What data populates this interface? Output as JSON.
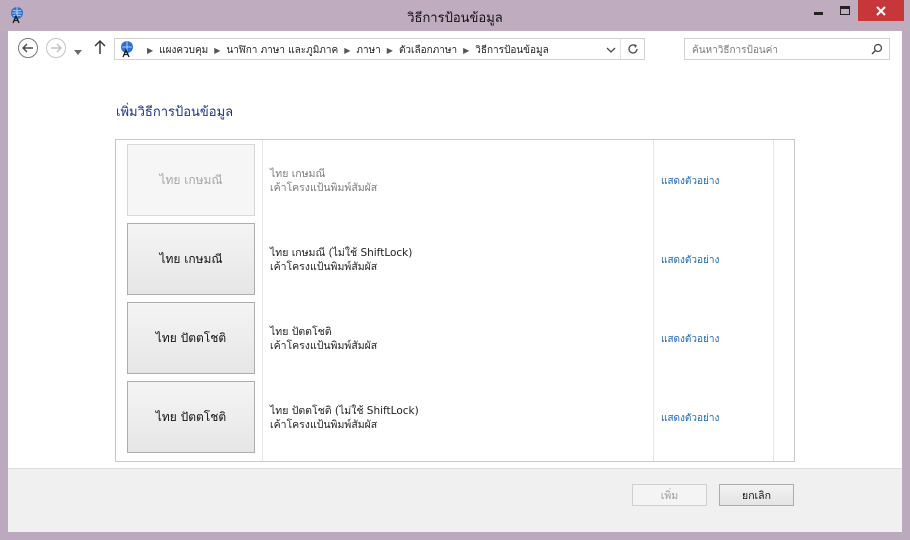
{
  "window": {
    "title": "วิธีการป้อนข้อมูล"
  },
  "nav": {
    "breadcrumbs": [
      "แผงควบคุม",
      "นาฬิกา ภาษา และภูมิภาค",
      "ภาษา",
      "ตัวเลือกภาษา",
      "วิธีการป้อนข้อมูล"
    ],
    "search_placeholder": "ค้นหาวิธีการป้อนค่า"
  },
  "page": {
    "heading": "เพิ่มวิธีการป้อนข้อมูล"
  },
  "layouts": [
    {
      "button_label": "ไทย เกษมณี",
      "name": "ไทย เกษมณี",
      "description": "เค้าโครงแป้นพิมพ์สัมผัส",
      "link": "แสดงตัวอย่าง",
      "state": "disabled"
    },
    {
      "button_label": "ไทย เกษมณี",
      "name": "ไทย เกษมณี (ไม่ใช้ ShiftLock)",
      "description": "เค้าโครงแป้นพิมพ์สัมผัส",
      "link": "แสดงตัวอย่าง",
      "state": "enabled"
    },
    {
      "button_label": "ไทย ปัตตโชติ",
      "name": "ไทย ปัตตโชติ",
      "description": "เค้าโครงแป้นพิมพ์สัมผัส",
      "link": "แสดงตัวอย่าง",
      "state": "enabled"
    },
    {
      "button_label": "ไทย ปัตตโชติ",
      "name": "ไทย ปัตตโชติ (ไม่ใช้ ShiftLock)",
      "description": "เค้าโครงแป้นพิมพ์สัมผัส",
      "link": "แสดงตัวอย่าง",
      "state": "enabled"
    }
  ],
  "footer": {
    "add_label": "เพิ่ม",
    "add_state": "disabled",
    "cancel_label": "ยกเลิก"
  },
  "colors": {
    "frame": "#bfadbf",
    "close_button": "#c7373a",
    "heading": "#1e3287",
    "link": "#1c67b3"
  },
  "icons": {
    "title_icon": "language-keyboard-icon",
    "address_icon": "language-keyboard-icon",
    "back": "back-arrow-icon",
    "forward": "forward-arrow-icon",
    "up": "up-arrow-icon",
    "refresh": "refresh-icon",
    "search": "search-icon"
  }
}
